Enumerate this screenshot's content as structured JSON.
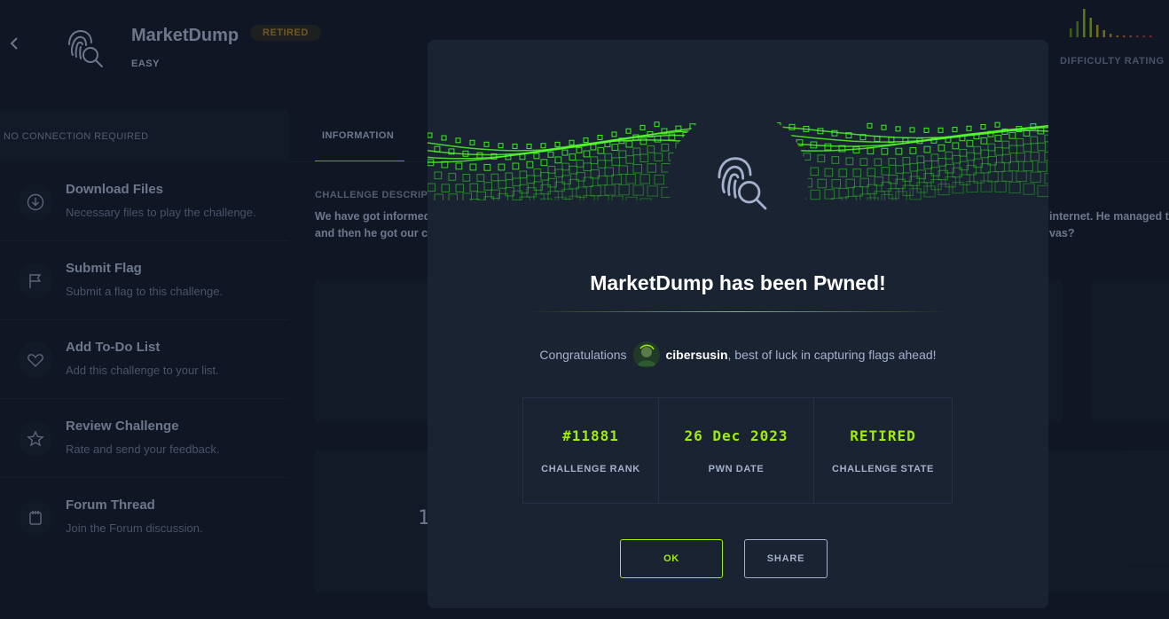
{
  "header": {
    "back_icon": "chevron-left-icon",
    "challenge_icon": "fingerprint-search-icon",
    "title": "MarketDump",
    "badge": "RETIRED",
    "difficulty": "EASY",
    "difficulty_rating_label": "DIFFICULTY RATING",
    "rating_colors": [
      "#5c8a1a",
      "#8cb21c",
      "#a8a020",
      "#b88820",
      "#b86030",
      "#a04040"
    ]
  },
  "sidebar": {
    "connection": "NO CONNECTION REQUIRED",
    "items": [
      {
        "icon": "download-icon",
        "title": "Download Files",
        "subtitle": "Necessary files to play the challenge."
      },
      {
        "icon": "flag-icon",
        "title": "Submit Flag",
        "subtitle": "Submit a flag to this challenge."
      },
      {
        "icon": "heart-icon",
        "title": "Add To-Do List",
        "subtitle": "Add this challenge to your list."
      },
      {
        "icon": "star-icon",
        "title": "Review Challenge",
        "subtitle": "Rate and send your feedback."
      },
      {
        "icon": "forum-icon",
        "title": "Forum Thread",
        "subtitle": "Join the Forum discussion."
      }
    ]
  },
  "main": {
    "tab": "INFORMATION",
    "description_heading": "CHALLENGE DESCRIPT",
    "description_line1": "We have got informed",
    "description_line2": "and then he got our c",
    "description_right1": "internet. He managed t",
    "description_right2": "vas?",
    "partial_number": "1"
  },
  "modal": {
    "title": "MarketDump has been Pwned!",
    "congrats_prefix": "Congratulations",
    "username": "cibersusin",
    "congrats_suffix": ", best of luck in capturing flags ahead!",
    "stats": [
      {
        "value": "#11881",
        "label": "CHALLENGE RANK"
      },
      {
        "value": "26 Dec 2023",
        "label": "PWN DATE"
      },
      {
        "value": "RETIRED",
        "label": "CHALLENGE STATE"
      }
    ],
    "ok_label": "OK",
    "share_label": "SHARE",
    "accent": "#9fef00"
  }
}
